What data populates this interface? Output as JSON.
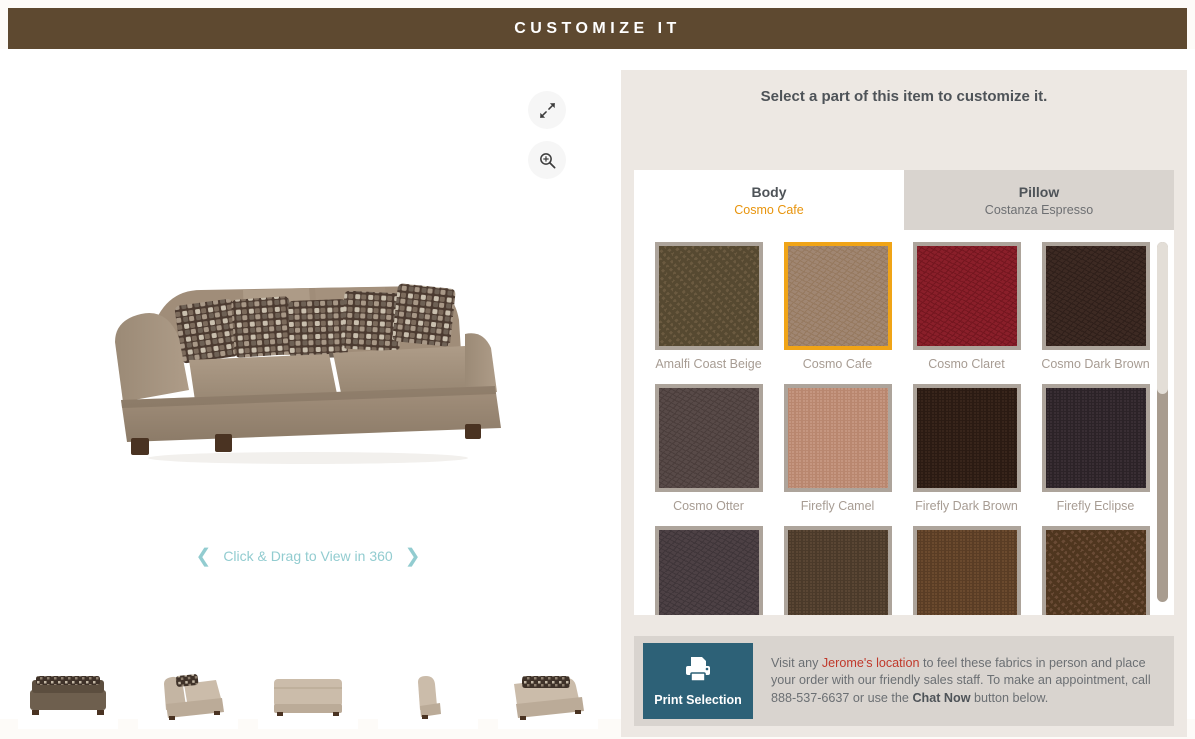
{
  "header": {
    "title": "CUSTOMIZE IT"
  },
  "viewer": {
    "expand_icon": "expand-arrows-icon",
    "zoom_icon": "magnifier-plus-icon",
    "rotate_label": "Click & Drag to View in 360",
    "chevron_left": "❮",
    "chevron_right": "❯",
    "product_alt": "Taupe upholstered sofa with patterned accent pillows",
    "thumbnails": [
      {
        "name": "thumb-front-dark",
        "angle": "front"
      },
      {
        "name": "thumb-three-quarter-left",
        "angle": "three-quarter-left"
      },
      {
        "name": "thumb-back",
        "angle": "back"
      },
      {
        "name": "thumb-side",
        "angle": "side"
      },
      {
        "name": "thumb-three-quarter-right",
        "angle": "three-quarter-right"
      }
    ]
  },
  "panel": {
    "heading": "Select a part of this item to customize it.",
    "tabs": [
      {
        "label": "Body",
        "selection": "Cosmo Cafe",
        "active": true
      },
      {
        "label": "Pillow",
        "selection": "Costanza Espresso",
        "active": false
      }
    ],
    "swatches": [
      {
        "label": "Amalfi Coast Beige",
        "color": "#6B5A40",
        "color2": "#564931",
        "pattern": "check",
        "selected": false
      },
      {
        "label": "Cosmo Cafe",
        "color": "#A08672",
        "color2": "#96795F",
        "pattern": "leather",
        "selected": true
      },
      {
        "label": "Cosmo Claret",
        "color": "#8A1F2A",
        "color2": "#74161F",
        "pattern": "leather",
        "selected": false
      },
      {
        "label": "Cosmo Dark Brown",
        "color": "#3D2A23",
        "color2": "#2F1F1A",
        "pattern": "leather",
        "selected": false
      },
      {
        "label": "Cosmo Otter",
        "color": "#584A48",
        "color2": "#4A3D3B",
        "pattern": "leather",
        "selected": false
      },
      {
        "label": "Firefly Camel",
        "color": "#C59680",
        "color2": "#B9876F",
        "pattern": "weave",
        "selected": false
      },
      {
        "label": "Firefly Dark Brown",
        "color": "#38251B",
        "color2": "#2B1B13",
        "pattern": "weave",
        "selected": false
      },
      {
        "label": "Firefly Eclipse",
        "color": "#392E34",
        "color2": "#2C2328",
        "pattern": "weave",
        "selected": false
      },
      {
        "label": "",
        "color": "#4D4145",
        "color2": "#3F3539",
        "pattern": "leather",
        "selected": false
      },
      {
        "label": "",
        "color": "#5A4634",
        "color2": "#4B3A2A",
        "pattern": "weave",
        "selected": false
      },
      {
        "label": "",
        "color": "#6B4A2E",
        "color2": "#5A3D25",
        "pattern": "weave",
        "selected": false
      },
      {
        "label": "",
        "color": "#6A4B35",
        "color2": "#4F361F",
        "pattern": "check",
        "selected": false
      }
    ],
    "scrollbar": {
      "name": "swatch-scrollbar"
    }
  },
  "infobox": {
    "print_icon": "printer-icon",
    "print_label": "Print Selection",
    "text_part1": "Visit any ",
    "link": "Jerome's location",
    "text_part2": " to feel these fabrics in person and place your order with our friendly sales staff. To make an appointment, call 888-537-6637 or use the ",
    "chat_label": "Chat Now",
    "text_part3": " button below."
  }
}
